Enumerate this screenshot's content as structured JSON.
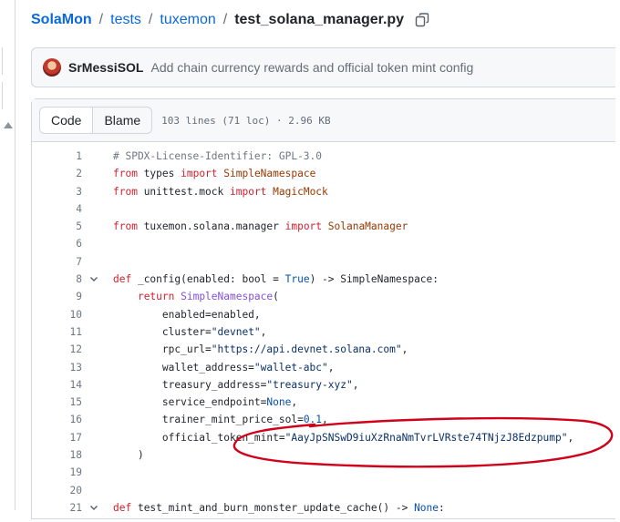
{
  "breadcrumb": {
    "repo": "SolaMon",
    "sep": "/",
    "dirs": [
      "tests",
      "tuxemon"
    ],
    "file": "test_solana_manager.py"
  },
  "commit": {
    "author": "SrMessiSOL",
    "message": "Add chain currency rewards and official token mint config"
  },
  "fileview": {
    "tabs": [
      "Code",
      "Blame"
    ],
    "active_tab": "Code",
    "info": "103 lines (71 loc) · 2.96 KB"
  },
  "code": {
    "lines": [
      {
        "n": "1",
        "fold": false,
        "tokens": [
          {
            "t": "# SPDX-License-Identifier: GPL-3.0",
            "c": "com"
          }
        ]
      },
      {
        "n": "2",
        "fold": false,
        "tokens": [
          {
            "t": "from",
            "c": "kw"
          },
          {
            "t": " types ",
            "c": ""
          },
          {
            "t": "import",
            "c": "kw"
          },
          {
            "t": " SimpleNamespace",
            "c": "cls"
          }
        ]
      },
      {
        "n": "3",
        "fold": false,
        "tokens": [
          {
            "t": "from",
            "c": "kw"
          },
          {
            "t": " unittest.mock ",
            "c": ""
          },
          {
            "t": "import",
            "c": "kw"
          },
          {
            "t": " MagicMock",
            "c": "cls"
          }
        ]
      },
      {
        "n": "4",
        "fold": false,
        "tokens": []
      },
      {
        "n": "5",
        "fold": false,
        "tokens": [
          {
            "t": "from",
            "c": "kw"
          },
          {
            "t": " tuxemon.solana.manager ",
            "c": ""
          },
          {
            "t": "import",
            "c": "kw"
          },
          {
            "t": " SolanaManager",
            "c": "cls"
          }
        ]
      },
      {
        "n": "6",
        "fold": false,
        "tokens": []
      },
      {
        "n": "7",
        "fold": false,
        "tokens": []
      },
      {
        "n": "8",
        "fold": true,
        "tokens": [
          {
            "t": "def",
            "c": "kw"
          },
          {
            "t": " _config(enabled: bool = ",
            "c": ""
          },
          {
            "t": "True",
            "c": "const"
          },
          {
            "t": ") -> SimpleNamespace:",
            "c": ""
          }
        ]
      },
      {
        "n": "9",
        "fold": false,
        "tokens": [
          {
            "t": "    ",
            "c": ""
          },
          {
            "t": "return",
            "c": "kw"
          },
          {
            "t": " SimpleNamespace",
            "c": "fn"
          },
          {
            "t": "(",
            "c": ""
          }
        ]
      },
      {
        "n": "10",
        "fold": false,
        "tokens": [
          {
            "t": "        enabled=enabled,",
            "c": ""
          }
        ]
      },
      {
        "n": "11",
        "fold": false,
        "tokens": [
          {
            "t": "        cluster=",
            "c": ""
          },
          {
            "t": "\"devnet\"",
            "c": "str"
          },
          {
            "t": ",",
            "c": ""
          }
        ]
      },
      {
        "n": "12",
        "fold": false,
        "tokens": [
          {
            "t": "        rpc_url=",
            "c": ""
          },
          {
            "t": "\"https://api.devnet.solana.com\"",
            "c": "str"
          },
          {
            "t": ",",
            "c": ""
          }
        ]
      },
      {
        "n": "13",
        "fold": false,
        "tokens": [
          {
            "t": "        wallet_address=",
            "c": ""
          },
          {
            "t": "\"wallet-abc\"",
            "c": "str"
          },
          {
            "t": ",",
            "c": ""
          }
        ]
      },
      {
        "n": "14",
        "fold": false,
        "tokens": [
          {
            "t": "        treasury_address=",
            "c": ""
          },
          {
            "t": "\"treasury-xyz\"",
            "c": "str"
          },
          {
            "t": ",",
            "c": ""
          }
        ]
      },
      {
        "n": "15",
        "fold": false,
        "tokens": [
          {
            "t": "        service_endpoint=",
            "c": ""
          },
          {
            "t": "None",
            "c": "const"
          },
          {
            "t": ",",
            "c": ""
          }
        ]
      },
      {
        "n": "16",
        "fold": false,
        "tokens": [
          {
            "t": "        trainer_mint_price_sol=",
            "c": ""
          },
          {
            "t": "0.1",
            "c": "const"
          },
          {
            "t": ",",
            "c": ""
          }
        ]
      },
      {
        "n": "17",
        "fold": false,
        "tokens": [
          {
            "t": "        official_token_mint=",
            "c": ""
          },
          {
            "t": "\"AayJpSNSwD9iuXzRnaNmTvrLVRste74TNjzJ8Edzpump\"",
            "c": "str"
          },
          {
            "t": ",",
            "c": ""
          }
        ]
      },
      {
        "n": "18",
        "fold": false,
        "tokens": [
          {
            "t": "    )",
            "c": ""
          }
        ]
      },
      {
        "n": "19",
        "fold": false,
        "tokens": []
      },
      {
        "n": "20",
        "fold": false,
        "tokens": []
      },
      {
        "n": "21",
        "fold": true,
        "tokens": [
          {
            "t": "def",
            "c": "kw"
          },
          {
            "t": " test_mint_and_burn_monster_update_cache() -> ",
            "c": ""
          },
          {
            "t": "None",
            "c": "const"
          },
          {
            "t": ":",
            "c": ""
          }
        ]
      }
    ]
  },
  "annotation": {
    "shape": "freehand-ellipse",
    "color": "#d0021b",
    "target_line": "17"
  },
  "icons": {
    "copy": "copy-icon",
    "fold": "chevron-down-icon",
    "rail": "caret-up-icon"
  }
}
